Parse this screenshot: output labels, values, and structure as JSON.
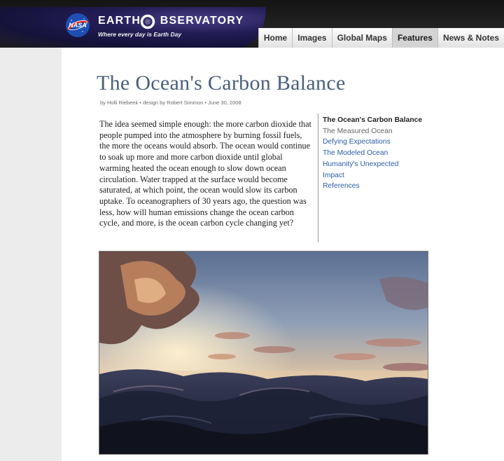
{
  "header": {
    "site_name_part1": "EARTH ",
    "site_name_part2": "BSERVATORY",
    "tagline": "Where every day is Earth Day",
    "logo_text": "NASA"
  },
  "nav": {
    "items": [
      {
        "label": "Home"
      },
      {
        "label": "Images"
      },
      {
        "label": "Global Maps"
      },
      {
        "label": "Features",
        "active": true
      },
      {
        "label": "News & Notes"
      }
    ]
  },
  "article": {
    "title": "The Ocean's Carbon Balance",
    "byline": "by Holli Riebeek • design by Robert Simmon • June 30, 2008",
    "intro": "The idea seemed simple enough: the more carbon dioxide that people pumped into the atmosphere by burning fossil fuels, the more the oceans would absorb. The ocean would continue to soak up more and more carbon dioxide until global warming heated the ocean enough to slow down ocean circulation. Water trapped at the surface would become saturated, at which point, the ocean would slow its carbon uptake. To oceanographers of 30 years ago, the question was less, how will human emissions change the ocean carbon cycle, and more, is the ocean carbon cycle changing yet?"
  },
  "toc": {
    "items": [
      {
        "label": "The Ocean's Carbon Balance",
        "state": "current"
      },
      {
        "label": "The Measured Ocean",
        "state": "visited"
      },
      {
        "label": "Defying Expectations",
        "state": "link"
      },
      {
        "label": "The Modeled Ocean",
        "state": "link"
      },
      {
        "label": "Humanity's Unexpected",
        "state": "link"
      },
      {
        "label": "Impact",
        "state": "link"
      },
      {
        "label": "References",
        "state": "link"
      }
    ]
  },
  "colors": {
    "title": "#4a5f7a",
    "link": "#2b5ea8",
    "banner": "#231d55"
  }
}
